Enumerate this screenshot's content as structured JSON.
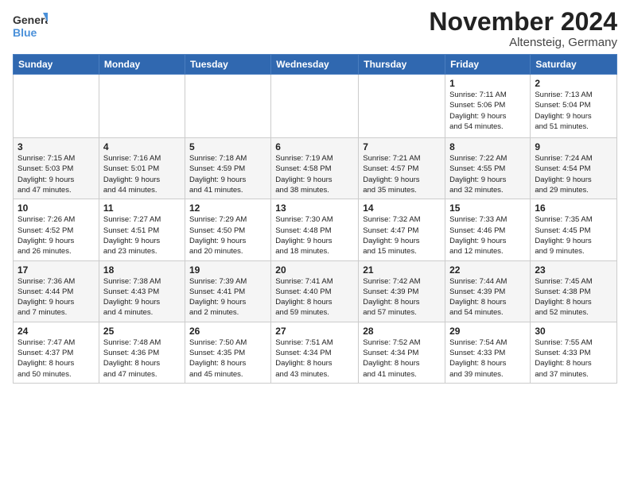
{
  "logo": {
    "text_general": "General",
    "text_blue": "Blue",
    "icon_unicode": "🔵"
  },
  "title": "November 2024",
  "location": "Altensteig, Germany",
  "days_of_week": [
    "Sunday",
    "Monday",
    "Tuesday",
    "Wednesday",
    "Thursday",
    "Friday",
    "Saturday"
  ],
  "weeks": [
    {
      "row_class": "row-white",
      "days": [
        {
          "num": "",
          "info": ""
        },
        {
          "num": "",
          "info": ""
        },
        {
          "num": "",
          "info": ""
        },
        {
          "num": "",
          "info": ""
        },
        {
          "num": "",
          "info": ""
        },
        {
          "num": "1",
          "info": "Sunrise: 7:11 AM\nSunset: 5:06 PM\nDaylight: 9 hours\nand 54 minutes."
        },
        {
          "num": "2",
          "info": "Sunrise: 7:13 AM\nSunset: 5:04 PM\nDaylight: 9 hours\nand 51 minutes."
        }
      ]
    },
    {
      "row_class": "row-gray",
      "days": [
        {
          "num": "3",
          "info": "Sunrise: 7:15 AM\nSunset: 5:03 PM\nDaylight: 9 hours\nand 47 minutes."
        },
        {
          "num": "4",
          "info": "Sunrise: 7:16 AM\nSunset: 5:01 PM\nDaylight: 9 hours\nand 44 minutes."
        },
        {
          "num": "5",
          "info": "Sunrise: 7:18 AM\nSunset: 4:59 PM\nDaylight: 9 hours\nand 41 minutes."
        },
        {
          "num": "6",
          "info": "Sunrise: 7:19 AM\nSunset: 4:58 PM\nDaylight: 9 hours\nand 38 minutes."
        },
        {
          "num": "7",
          "info": "Sunrise: 7:21 AM\nSunset: 4:57 PM\nDaylight: 9 hours\nand 35 minutes."
        },
        {
          "num": "8",
          "info": "Sunrise: 7:22 AM\nSunset: 4:55 PM\nDaylight: 9 hours\nand 32 minutes."
        },
        {
          "num": "9",
          "info": "Sunrise: 7:24 AM\nSunset: 4:54 PM\nDaylight: 9 hours\nand 29 minutes."
        }
      ]
    },
    {
      "row_class": "row-white",
      "days": [
        {
          "num": "10",
          "info": "Sunrise: 7:26 AM\nSunset: 4:52 PM\nDaylight: 9 hours\nand 26 minutes."
        },
        {
          "num": "11",
          "info": "Sunrise: 7:27 AM\nSunset: 4:51 PM\nDaylight: 9 hours\nand 23 minutes."
        },
        {
          "num": "12",
          "info": "Sunrise: 7:29 AM\nSunset: 4:50 PM\nDaylight: 9 hours\nand 20 minutes."
        },
        {
          "num": "13",
          "info": "Sunrise: 7:30 AM\nSunset: 4:48 PM\nDaylight: 9 hours\nand 18 minutes."
        },
        {
          "num": "14",
          "info": "Sunrise: 7:32 AM\nSunset: 4:47 PM\nDaylight: 9 hours\nand 15 minutes."
        },
        {
          "num": "15",
          "info": "Sunrise: 7:33 AM\nSunset: 4:46 PM\nDaylight: 9 hours\nand 12 minutes."
        },
        {
          "num": "16",
          "info": "Sunrise: 7:35 AM\nSunset: 4:45 PM\nDaylight: 9 hours\nand 9 minutes."
        }
      ]
    },
    {
      "row_class": "row-gray",
      "days": [
        {
          "num": "17",
          "info": "Sunrise: 7:36 AM\nSunset: 4:44 PM\nDaylight: 9 hours\nand 7 minutes."
        },
        {
          "num": "18",
          "info": "Sunrise: 7:38 AM\nSunset: 4:43 PM\nDaylight: 9 hours\nand 4 minutes."
        },
        {
          "num": "19",
          "info": "Sunrise: 7:39 AM\nSunset: 4:41 PM\nDaylight: 9 hours\nand 2 minutes."
        },
        {
          "num": "20",
          "info": "Sunrise: 7:41 AM\nSunset: 4:40 PM\nDaylight: 8 hours\nand 59 minutes."
        },
        {
          "num": "21",
          "info": "Sunrise: 7:42 AM\nSunset: 4:39 PM\nDaylight: 8 hours\nand 57 minutes."
        },
        {
          "num": "22",
          "info": "Sunrise: 7:44 AM\nSunset: 4:39 PM\nDaylight: 8 hours\nand 54 minutes."
        },
        {
          "num": "23",
          "info": "Sunrise: 7:45 AM\nSunset: 4:38 PM\nDaylight: 8 hours\nand 52 minutes."
        }
      ]
    },
    {
      "row_class": "row-white",
      "days": [
        {
          "num": "24",
          "info": "Sunrise: 7:47 AM\nSunset: 4:37 PM\nDaylight: 8 hours\nand 50 minutes."
        },
        {
          "num": "25",
          "info": "Sunrise: 7:48 AM\nSunset: 4:36 PM\nDaylight: 8 hours\nand 47 minutes."
        },
        {
          "num": "26",
          "info": "Sunrise: 7:50 AM\nSunset: 4:35 PM\nDaylight: 8 hours\nand 45 minutes."
        },
        {
          "num": "27",
          "info": "Sunrise: 7:51 AM\nSunset: 4:34 PM\nDaylight: 8 hours\nand 43 minutes."
        },
        {
          "num": "28",
          "info": "Sunrise: 7:52 AM\nSunset: 4:34 PM\nDaylight: 8 hours\nand 41 minutes."
        },
        {
          "num": "29",
          "info": "Sunrise: 7:54 AM\nSunset: 4:33 PM\nDaylight: 8 hours\nand 39 minutes."
        },
        {
          "num": "30",
          "info": "Sunrise: 7:55 AM\nSunset: 4:33 PM\nDaylight: 8 hours\nand 37 minutes."
        }
      ]
    }
  ]
}
